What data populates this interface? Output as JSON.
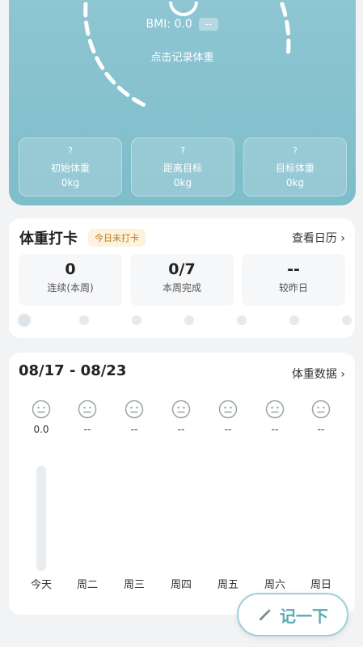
{
  "hero": {
    "bmi_label": "BMI: 0.0",
    "bmi_tag": "--",
    "hint": "点击记录体重",
    "stats": [
      {
        "q": "?",
        "label": "初始体重",
        "value": "0kg"
      },
      {
        "q": "?",
        "label": "距离目标",
        "value": "0kg"
      },
      {
        "q": "?",
        "label": "目标体重",
        "value": "0kg"
      }
    ]
  },
  "checkin": {
    "title": "体重打卡",
    "badge": "今日未打卡",
    "link": "查看日历 ›",
    "stats": [
      {
        "num": "0",
        "sub": "连续(本周)"
      },
      {
        "num": "0/7",
        "sub": "本周完成"
      },
      {
        "num": "--",
        "sub": "较昨日"
      }
    ]
  },
  "week": {
    "range": "08/17 - 08/23",
    "link": "体重数据 ›",
    "days": [
      {
        "label": "今天",
        "value": "0.0"
      },
      {
        "label": "周二",
        "value": "--"
      },
      {
        "label": "周三",
        "value": "--"
      },
      {
        "label": "周四",
        "value": "--"
      },
      {
        "label": "周五",
        "value": "--"
      },
      {
        "label": "周六",
        "value": "--"
      },
      {
        "label": "周日",
        "value": "--"
      }
    ]
  },
  "fab": {
    "label": "记一下",
    "icon": "pencil-icon"
  },
  "colors": {
    "hero": "#8ec6d2",
    "accent": "#5aa9b8",
    "badge_bg": "#fdf2dc",
    "badge_text": "#b97c1c"
  }
}
